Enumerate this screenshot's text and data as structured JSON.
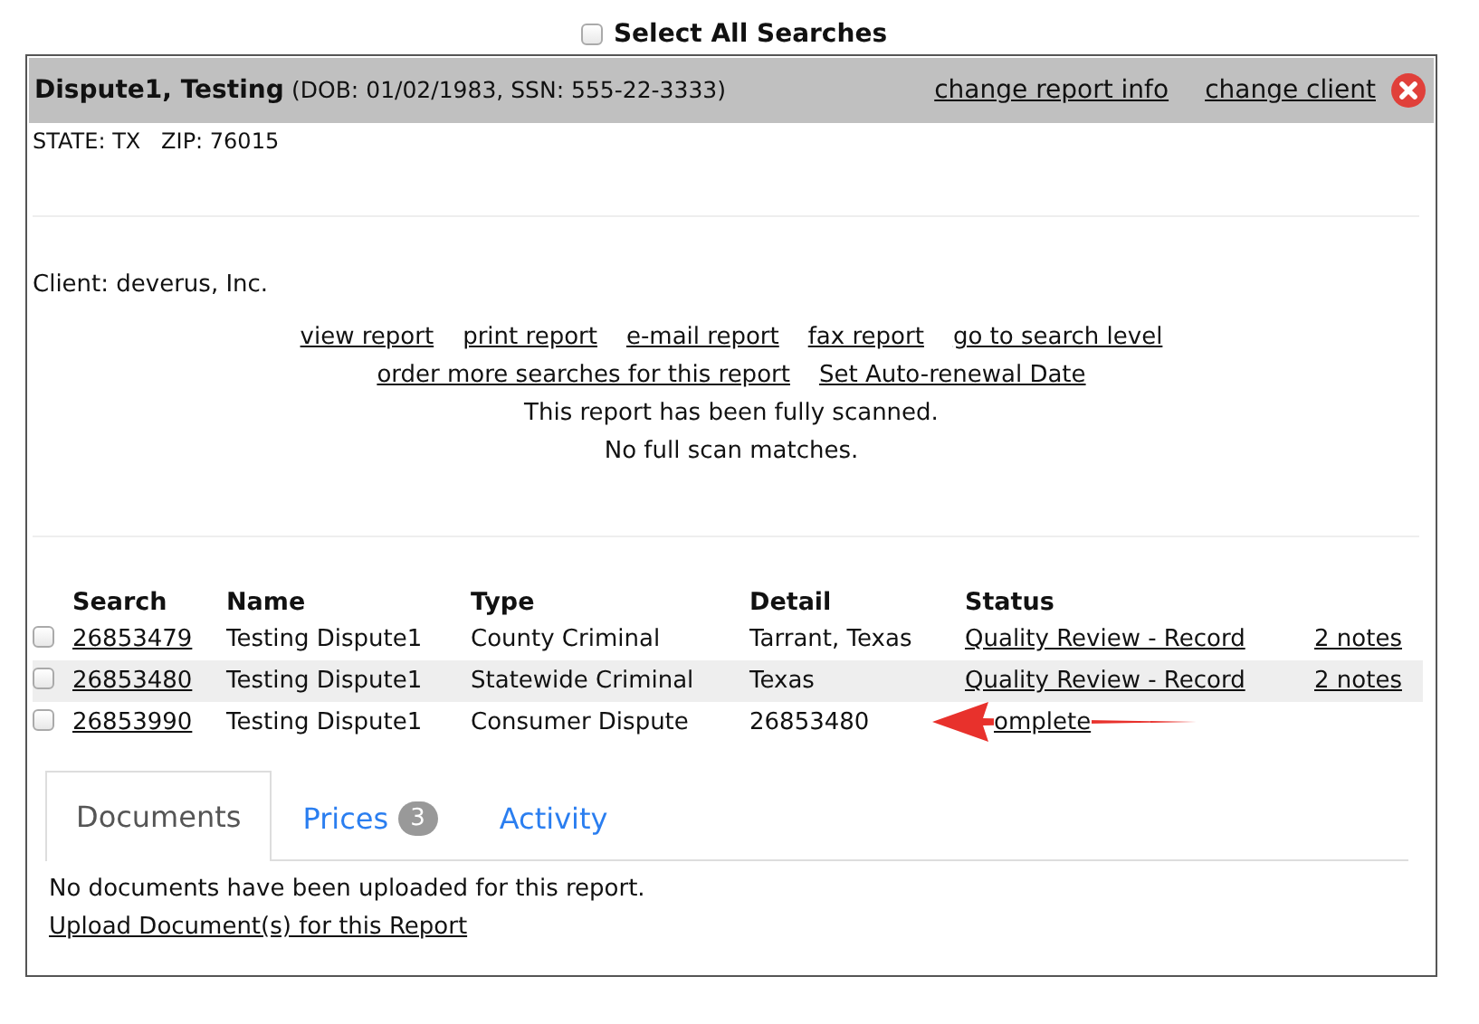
{
  "select_all": {
    "label": "Select All Searches",
    "checked": false
  },
  "subject": {
    "name": "Dispute1, Testing",
    "details": "(DOB: 01/02/1983, SSN: 555-22-3333)",
    "links": [
      "change report info",
      "change client"
    ],
    "address": "STATE: TX   ZIP: 76015"
  },
  "client": "Client: deverus, Inc.",
  "report_links": [
    [
      "view report ",
      "print report ",
      "e-mail report ",
      "fax report ",
      "go to search level"
    ],
    [
      "order more searches for this report",
      "Set Auto-renewal Date"
    ]
  ],
  "messages": [
    "This report has been fully scanned.",
    "No full scan matches."
  ],
  "table": {
    "columns": [
      "Search",
      "Name",
      "Type",
      "Detail",
      "Status"
    ],
    "rows": [
      {
        "checked": false,
        "highlighted": false,
        "search": "26853479",
        "name": "Testing Dispute1",
        "type": "County Criminal",
        "detail": "Tarrant, Texas",
        "status": "Quality Review - Record",
        "notes": "2 notes"
      },
      {
        "checked": false,
        "highlighted": true,
        "search": "26853480",
        "name": "Testing Dispute1",
        "type": "Statewide Criminal",
        "detail": "Texas",
        "status": "Quality Review - Record",
        "notes": "2 notes"
      },
      {
        "checked": false,
        "highlighted": false,
        "search": "26853990",
        "name": "Testing Dispute1",
        "type": "Consumer Dispute",
        "detail": "26853480",
        "status": "omplete",
        "arrow": true
      }
    ]
  },
  "tabs": [
    {
      "label": "Documents",
      "selected": true
    },
    {
      "label": "Prices",
      "badge": "3",
      "selected": false
    },
    {
      "label": "Activity",
      "selected": false
    }
  ],
  "documents": {
    "message": "No documents have been uploaded for this report.",
    "upload_link": "Upload Document(s) for this Report"
  }
}
